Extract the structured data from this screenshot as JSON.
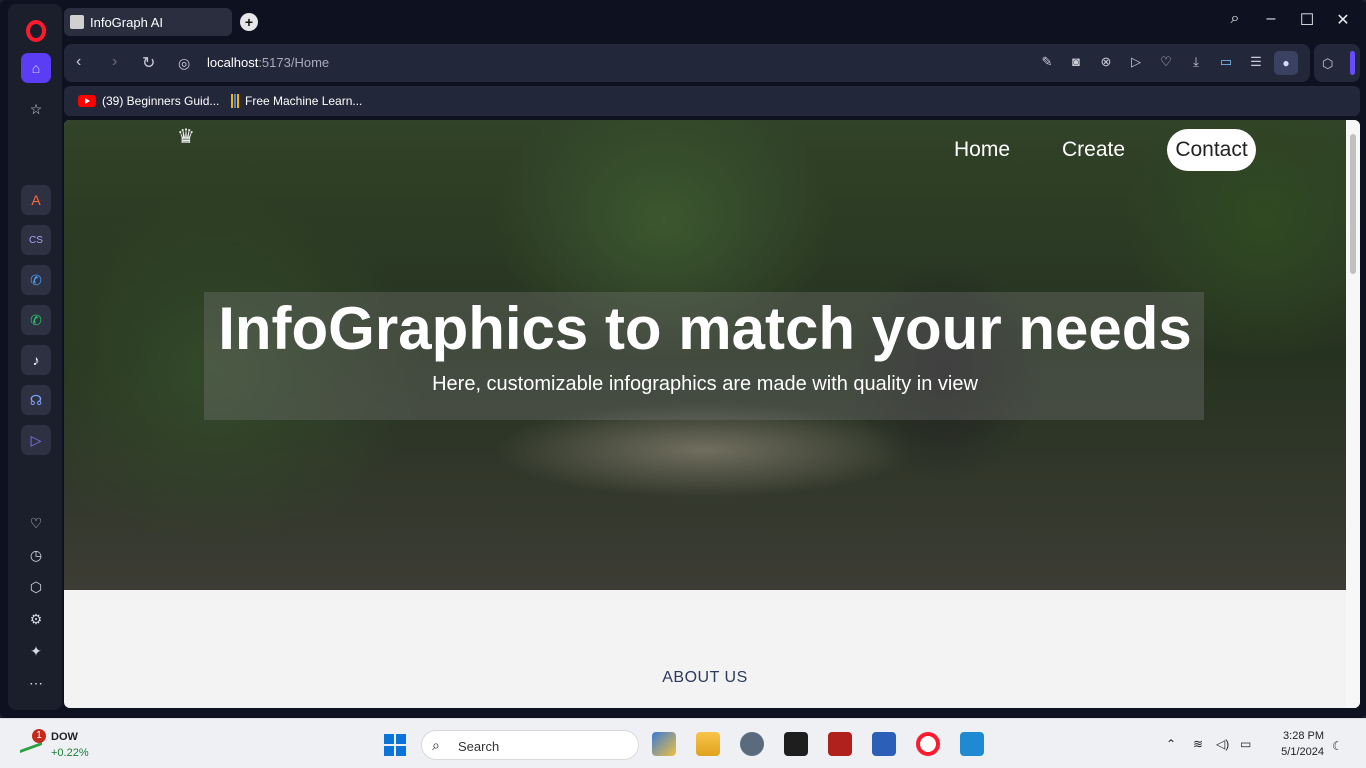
{
  "browser": {
    "tab_title": "InfoGraph AI",
    "new_tab": "+",
    "url_host": "localhost",
    "url_path": ":5173/Home",
    "bookmarks": [
      {
        "label": "(39) Beginners Guid...",
        "icon": "youtube-icon"
      },
      {
        "label": "Free Machine Learn...",
        "icon": "bars-icon"
      }
    ]
  },
  "site": {
    "nav": {
      "home": "Home",
      "create": "Create",
      "contact": "Contact"
    },
    "hero_title": "InfoGraphics to match your needs",
    "hero_subtitle": "Here, customizable infographics are made with quality in view",
    "about_heading": "ABOUT US"
  },
  "taskbar": {
    "ticker_badge": "1",
    "ticker_name": "DOW",
    "ticker_change": "+0.22%",
    "search_placeholder": "Search",
    "time": "3:28 PM",
    "date": "5/1/2024"
  },
  "colors": {
    "opera_red": "#ff1b2d",
    "accent_purple": "#6a4cff",
    "windows_blue": "#0a74d8"
  }
}
